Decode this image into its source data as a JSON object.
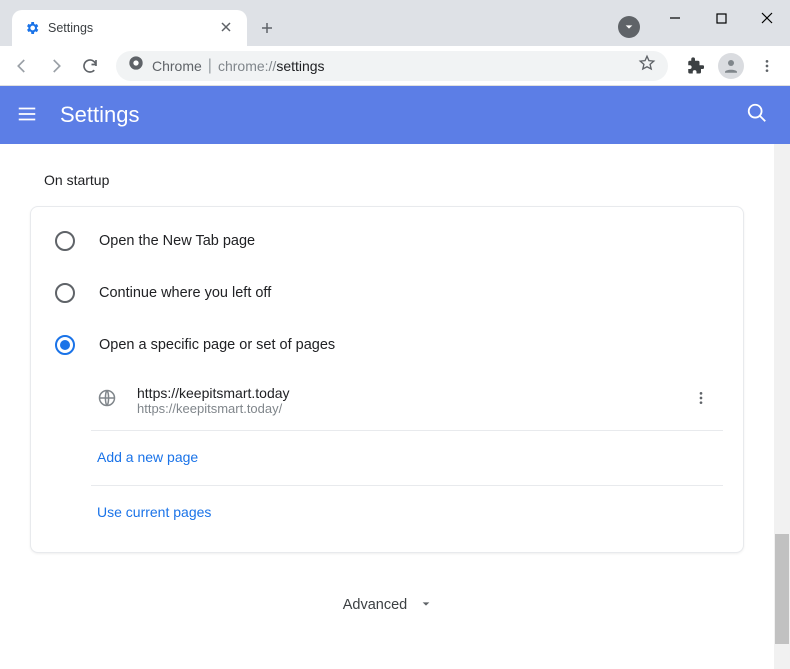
{
  "window": {
    "tab_title": "Settings"
  },
  "addressbar": {
    "scheme_label": "Chrome",
    "url_prefix": "chrome://",
    "url_path": "settings",
    "full_url": "chrome://settings"
  },
  "header": {
    "title": "Settings"
  },
  "section": {
    "title": "On startup",
    "radios": [
      {
        "label": "Open the New Tab page",
        "selected": false
      },
      {
        "label": "Continue where you left off",
        "selected": false
      },
      {
        "label": "Open a specific page or set of pages",
        "selected": true
      }
    ],
    "page_entry": {
      "title": "https://keepitsmart.today",
      "url": "https://keepitsmart.today/"
    },
    "add_page_label": "Add a new page",
    "use_current_label": "Use current pages"
  },
  "advanced_label": "Advanced"
}
